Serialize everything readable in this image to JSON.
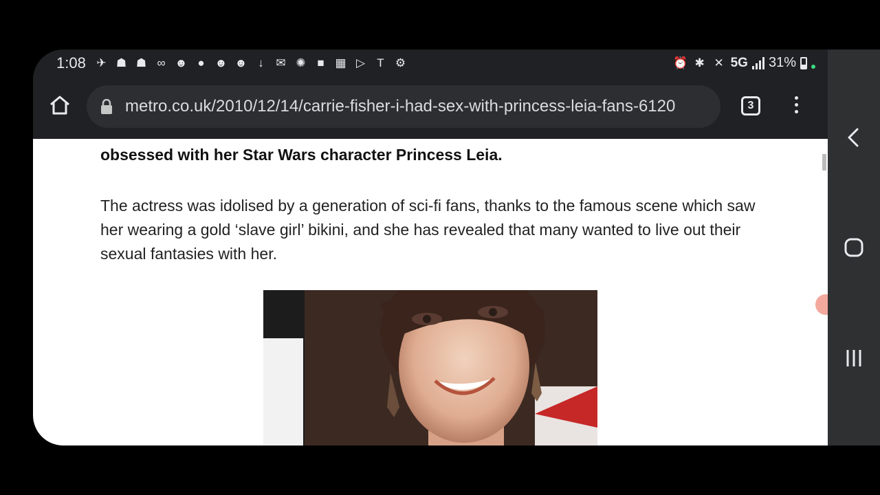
{
  "status_bar": {
    "time": "1:08",
    "notification_icons": [
      "telegram-icon",
      "snapchat-icon",
      "snapchat-icon",
      "voicemail-icon",
      "reddit-icon",
      "person-icon",
      "reddit-icon",
      "reddit-icon",
      "download-icon",
      "mail-icon",
      "settings-icon",
      "video-icon",
      "ifttt-icon",
      "play-icon",
      "tmobile-icon",
      "gear-icon"
    ],
    "network": "5G",
    "battery": "31%"
  },
  "browser": {
    "url": "metro.co.uk/2010/12/14/carrie-fisher-i-had-sex-with-princess-leia-fans-6120",
    "tab_count": "3"
  },
  "article": {
    "lead_bold": "obsessed with her Star Wars character Princess Leia.",
    "paragraph": "The actress was idolised by a generation of sci-fi fans, thanks to the famous scene which saw her wearing a gold ‘slave girl’ bikini, and she has revealed that many wanted to live out their sexual fantasies with her."
  },
  "colors": {
    "chrome_dark": "#202124",
    "url_bar": "#2c2e31",
    "nav_bar": "#2f3032",
    "page_bg": "#ffffff"
  }
}
